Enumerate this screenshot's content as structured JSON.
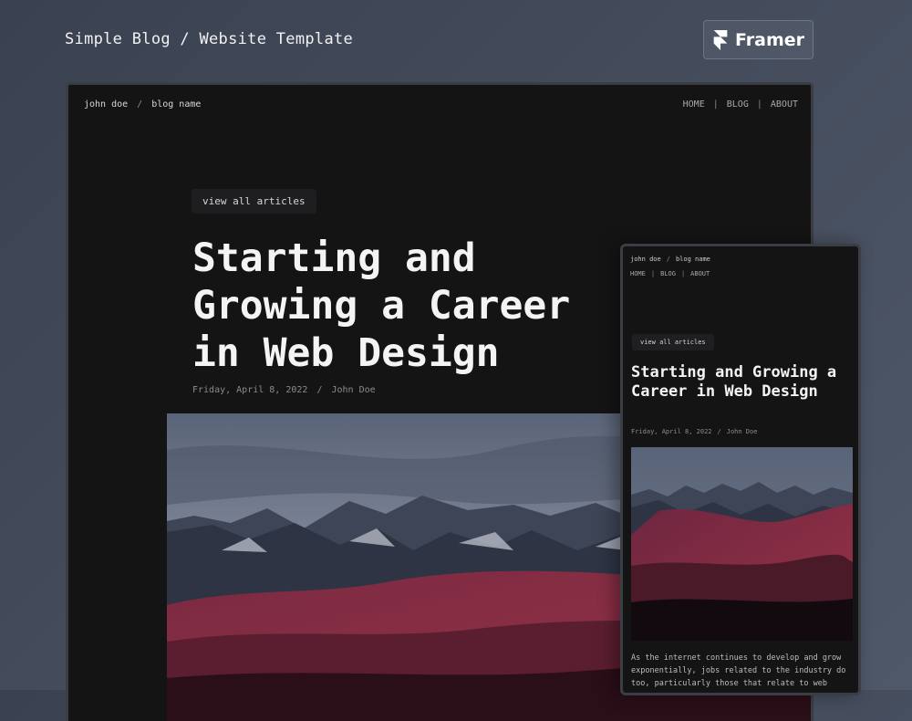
{
  "page": {
    "title": "Simple Blog / Website Template",
    "badge_label": "Framer"
  },
  "desktop": {
    "nav": {
      "author": "john doe",
      "separator": "/",
      "blog_name": "blog name",
      "links": [
        "HOME",
        "BLOG",
        "ABOUT"
      ],
      "link_separator": "|"
    },
    "view_all_label": "view all articles",
    "headline": "Starting and Growing a Career in Web Design",
    "meta": {
      "date": "Friday, April 8, 2022",
      "separator": "/",
      "author": "John Doe"
    }
  },
  "mobile": {
    "nav": {
      "author": "john doe",
      "separator": "/",
      "blog_name": "blog name",
      "links": [
        "HOME",
        "BLOG",
        "ABOUT"
      ],
      "link_separator": "|"
    },
    "view_all_label": "view all articles",
    "headline": "Starting and Growing a Career in Web Design",
    "meta": {
      "date": "Friday, April 8, 2022",
      "separator": "/",
      "author": "John Doe"
    },
    "body_text": "As the internet continues to develop and grow exponentially, jobs related to the industry do too, particularly those that relate to web"
  },
  "icons": {
    "framer_logo": "framer-logo-icon"
  },
  "colors": {
    "background": "#414958",
    "panel": "#141415",
    "headline": "#f4f4f4",
    "muted": "#8c8c8c"
  }
}
